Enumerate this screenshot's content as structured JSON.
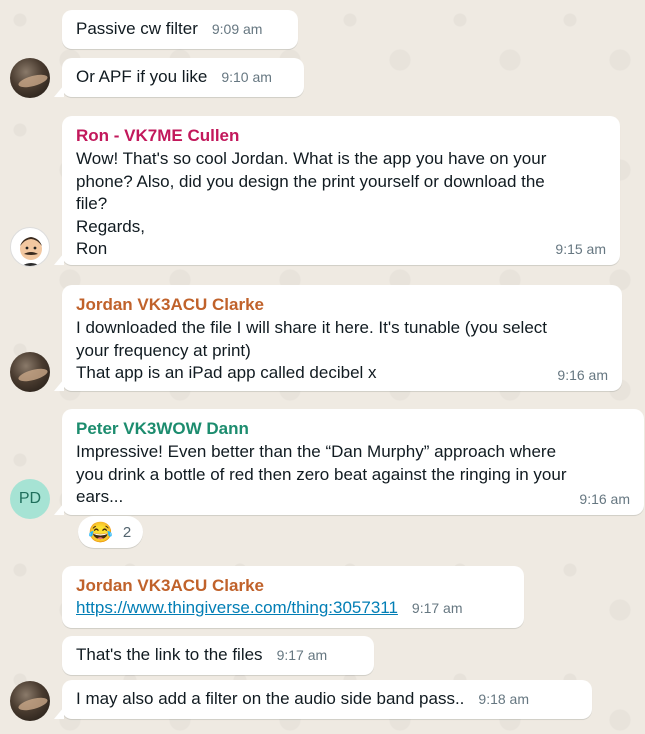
{
  "colors": {
    "ron_name": "#c2185b",
    "jordan_name": "#c0622b",
    "peter_name": "#1c8c6e",
    "link": "#027eb5",
    "timestamp": "#667781"
  },
  "messages": [
    {
      "id": "m1",
      "sender": "",
      "text": "Passive cw filter",
      "time": "9:09 am"
    },
    {
      "id": "m2",
      "sender": "",
      "text": "Or APF if you like",
      "time": "9:10 am",
      "avatar": "photo"
    },
    {
      "id": "m3",
      "sender": "Ron - VK7ME Cullen",
      "text": "Wow! That's so cool Jordan. What is the app you have on your\nphone? Also, did you design the print yourself or download the\nfile?\nRegards,\nRon",
      "time": "9:15 am",
      "avatar": "cartoon"
    },
    {
      "id": "m4",
      "sender": "Jordan VK3ACU Clarke",
      "text": "I downloaded the file I will share it here. It's tunable (you select\nyour frequency at print)\nThat app is an iPad app called decibel x",
      "time": "9:16 am",
      "avatar": "photo"
    },
    {
      "id": "m5",
      "sender": "Peter VK3WOW Dann",
      "text": "Impressive! Even better than the “Dan Murphy” approach where\nyou drink a bottle of red then zero beat against the ringing in your\nears...",
      "time": "9:16 am",
      "avatar": "initials",
      "avatar_initials": "PD",
      "reaction": {
        "emoji": "😂",
        "count": "2"
      }
    },
    {
      "id": "m6",
      "sender": "Jordan VK3ACU Clarke",
      "link": "https://www.thingiverse.com/thing:3057311",
      "time": "9:17 am"
    },
    {
      "id": "m7",
      "sender": "",
      "text": "That's the link to the files",
      "time": "9:17 am"
    },
    {
      "id": "m8",
      "sender": "",
      "text": "I may also add a filter on the audio side band pass..",
      "time": "9:18 am",
      "avatar": "photo"
    }
  ]
}
